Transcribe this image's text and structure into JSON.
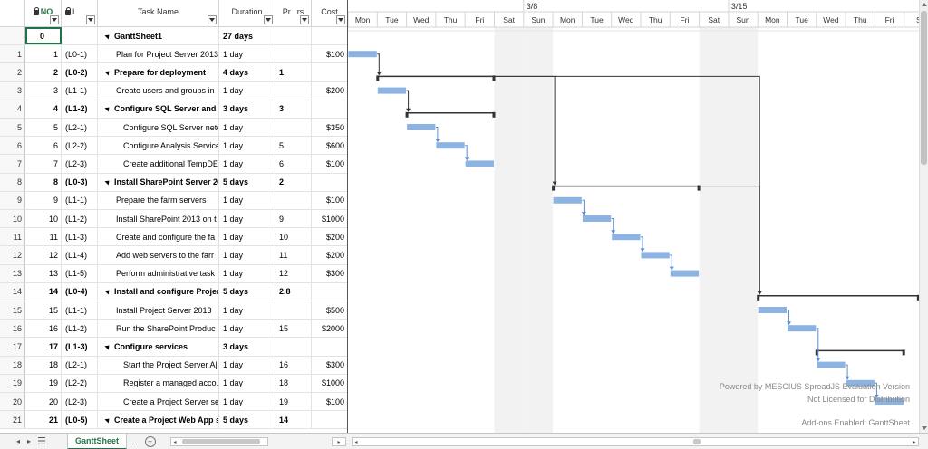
{
  "columns": {
    "no": "NO",
    "level": "L",
    "task": "Task Name",
    "duration": "Duration",
    "predecessors": "Pr...rs",
    "cost": "Cost"
  },
  "rows": [
    {
      "rh": "",
      "no": "0",
      "level": "",
      "task": "GanttSheet1",
      "duration": "27 days",
      "pred": "",
      "cost": "",
      "summary": true,
      "indent": 0,
      "selected": true
    },
    {
      "rh": "1",
      "no": "1",
      "level": "(L0-1)",
      "task": "Plan for Project Server 2013",
      "duration": "1 day",
      "pred": "",
      "cost": "$100",
      "summary": false,
      "indent": 1
    },
    {
      "rh": "2",
      "no": "2",
      "level": "(L0-2)",
      "task": "Prepare for deployment",
      "duration": "4 days",
      "pred": "1",
      "cost": "",
      "summary": true,
      "indent": 0
    },
    {
      "rh": "3",
      "no": "3",
      "level": "(L1-1)",
      "task": "Create users and groups in",
      "duration": "1 day",
      "pred": "",
      "cost": "$200",
      "summary": false,
      "indent": 1
    },
    {
      "rh": "4",
      "no": "4",
      "level": "(L1-2)",
      "task": "Configure SQL Server and /",
      "duration": "3 days",
      "pred": "3",
      "cost": "",
      "summary": true,
      "indent": 0
    },
    {
      "rh": "5",
      "no": "5",
      "level": "(L2-1)",
      "task": "Configure SQL Server netv",
      "duration": "1 day",
      "pred": "",
      "cost": "$350",
      "summary": false,
      "indent": 2
    },
    {
      "rh": "6",
      "no": "6",
      "level": "(L2-2)",
      "task": "Configure Analysis Service",
      "duration": "1 day",
      "pred": "5",
      "cost": "$600",
      "summary": false,
      "indent": 2
    },
    {
      "rh": "7",
      "no": "7",
      "level": "(L2-3)",
      "task": "Create additional TempDE",
      "duration": "1 day",
      "pred": "6",
      "cost": "$100",
      "summary": false,
      "indent": 2
    },
    {
      "rh": "8",
      "no": "8",
      "level": "(L0-3)",
      "task": "Install SharePoint Server 20",
      "duration": "5 days",
      "pred": "2",
      "cost": "",
      "summary": true,
      "indent": 0
    },
    {
      "rh": "9",
      "no": "9",
      "level": "(L1-1)",
      "task": "Prepare the farm servers",
      "duration": "1 day",
      "pred": "",
      "cost": "$100",
      "summary": false,
      "indent": 1
    },
    {
      "rh": "10",
      "no": "10",
      "level": "(L1-2)",
      "task": "Install SharePoint 2013 on t",
      "duration": "1 day",
      "pred": "9",
      "cost": "$1000",
      "summary": false,
      "indent": 1
    },
    {
      "rh": "11",
      "no": "11",
      "level": "(L1-3)",
      "task": "Create and configure the fa",
      "duration": "1 day",
      "pred": "10",
      "cost": "$200",
      "summary": false,
      "indent": 1
    },
    {
      "rh": "12",
      "no": "12",
      "level": "(L1-4)",
      "task": "Add web servers to the farr",
      "duration": "1 day",
      "pred": "11",
      "cost": "$200",
      "summary": false,
      "indent": 1
    },
    {
      "rh": "13",
      "no": "13",
      "level": "(L1-5)",
      "task": "Perform administrative task",
      "duration": "1 day",
      "pred": "12",
      "cost": "$300",
      "summary": false,
      "indent": 1
    },
    {
      "rh": "14",
      "no": "14",
      "level": "(L0-4)",
      "task": "Install and configure Project",
      "duration": "5 days",
      "pred": "2,8",
      "cost": "",
      "summary": true,
      "indent": 0
    },
    {
      "rh": "15",
      "no": "15",
      "level": "(L1-1)",
      "task": "Install Project Server 2013",
      "duration": "1 day",
      "pred": "",
      "cost": "$500",
      "summary": false,
      "indent": 1
    },
    {
      "rh": "16",
      "no": "16",
      "level": "(L1-2)",
      "task": "Run the SharePoint Produc",
      "duration": "1 day",
      "pred": "15",
      "cost": "$2000",
      "summary": false,
      "indent": 1
    },
    {
      "rh": "17",
      "no": "17",
      "level": "(L1-3)",
      "task": "Configure services",
      "duration": "3 days",
      "pred": "",
      "cost": "",
      "summary": true,
      "indent": 0
    },
    {
      "rh": "18",
      "no": "18",
      "level": "(L2-1)",
      "task": "Start the Project Server A|",
      "duration": "1 day",
      "pred": "16",
      "cost": "$300",
      "summary": false,
      "indent": 2
    },
    {
      "rh": "19",
      "no": "19",
      "level": "(L2-2)",
      "task": "Register a managed accou",
      "duration": "1 day",
      "pred": "18",
      "cost": "$1000",
      "summary": false,
      "indent": 2
    },
    {
      "rh": "20",
      "no": "20",
      "level": "(L2-3)",
      "task": "Create a Project Server se",
      "duration": "1 day",
      "pred": "19",
      "cost": "$100",
      "summary": false,
      "indent": 2
    },
    {
      "rh": "21",
      "no": "21",
      "level": "(L0-5)",
      "task": "Create a Project Web App si",
      "duration": "5 days",
      "pred": "14",
      "cost": "",
      "summary": true,
      "indent": 0
    }
  ],
  "timescale": {
    "weeks": [
      {
        "label": "3/8",
        "day_index": 6
      },
      {
        "label": "3/15",
        "day_index": 13
      }
    ],
    "days": [
      "Mon",
      "Tue",
      "Wed",
      "Thu",
      "Fri",
      "Sat",
      "Sun",
      "Mon",
      "Tue",
      "Wed",
      "Thu",
      "Fri",
      "Sat",
      "Sun",
      "Mon",
      "Tue",
      "Wed",
      "Thu",
      "Fri",
      "S"
    ],
    "weekend_day_indexes": [
      5,
      6,
      12,
      13
    ]
  },
  "gantt_tasks": [
    {
      "row": 1,
      "start": 0,
      "dur": 1,
      "type": "task"
    },
    {
      "row": 2,
      "start": 1,
      "dur": 4,
      "type": "summary"
    },
    {
      "row": 3,
      "start": 1,
      "dur": 1,
      "type": "task"
    },
    {
      "row": 4,
      "start": 2,
      "dur": 3,
      "type": "summary"
    },
    {
      "row": 5,
      "start": 2,
      "dur": 1,
      "type": "task"
    },
    {
      "row": 6,
      "start": 3,
      "dur": 1,
      "type": "task"
    },
    {
      "row": 7,
      "start": 4,
      "dur": 1,
      "type": "task"
    },
    {
      "row": 8,
      "start": 7,
      "dur": 5,
      "type": "summary"
    },
    {
      "row": 9,
      "start": 7,
      "dur": 1,
      "type": "task"
    },
    {
      "row": 10,
      "start": 8,
      "dur": 1,
      "type": "task"
    },
    {
      "row": 11,
      "start": 9,
      "dur": 1,
      "type": "task"
    },
    {
      "row": 12,
      "start": 10,
      "dur": 1,
      "type": "task"
    },
    {
      "row": 13,
      "start": 11,
      "dur": 1,
      "type": "task"
    },
    {
      "row": 14,
      "start": 14,
      "dur": 5.5,
      "type": "summary"
    },
    {
      "row": 15,
      "start": 14,
      "dur": 1,
      "type": "task"
    },
    {
      "row": 16,
      "start": 15,
      "dur": 1,
      "type": "task"
    },
    {
      "row": 17,
      "start": 16,
      "dur": 3,
      "type": "summary"
    },
    {
      "row": 18,
      "start": 16,
      "dur": 1,
      "type": "task"
    },
    {
      "row": 19,
      "start": 17,
      "dur": 1,
      "type": "task"
    },
    {
      "row": 20,
      "start": 18,
      "dur": 1,
      "type": "task"
    }
  ],
  "watermark": {
    "line1": "Powered by MESCIUS SpreadJS Evaluation Version",
    "line2": "Not Licensed for Distribution",
    "line3": "Add-ons Enabled: GanttSheet"
  },
  "tabs": {
    "active": "GanttSheet",
    "more": "..."
  },
  "colors": {
    "bar": "#8db3e2",
    "accent": "#217346",
    "weekend": "#f2f2f2",
    "summary": "#333333"
  }
}
